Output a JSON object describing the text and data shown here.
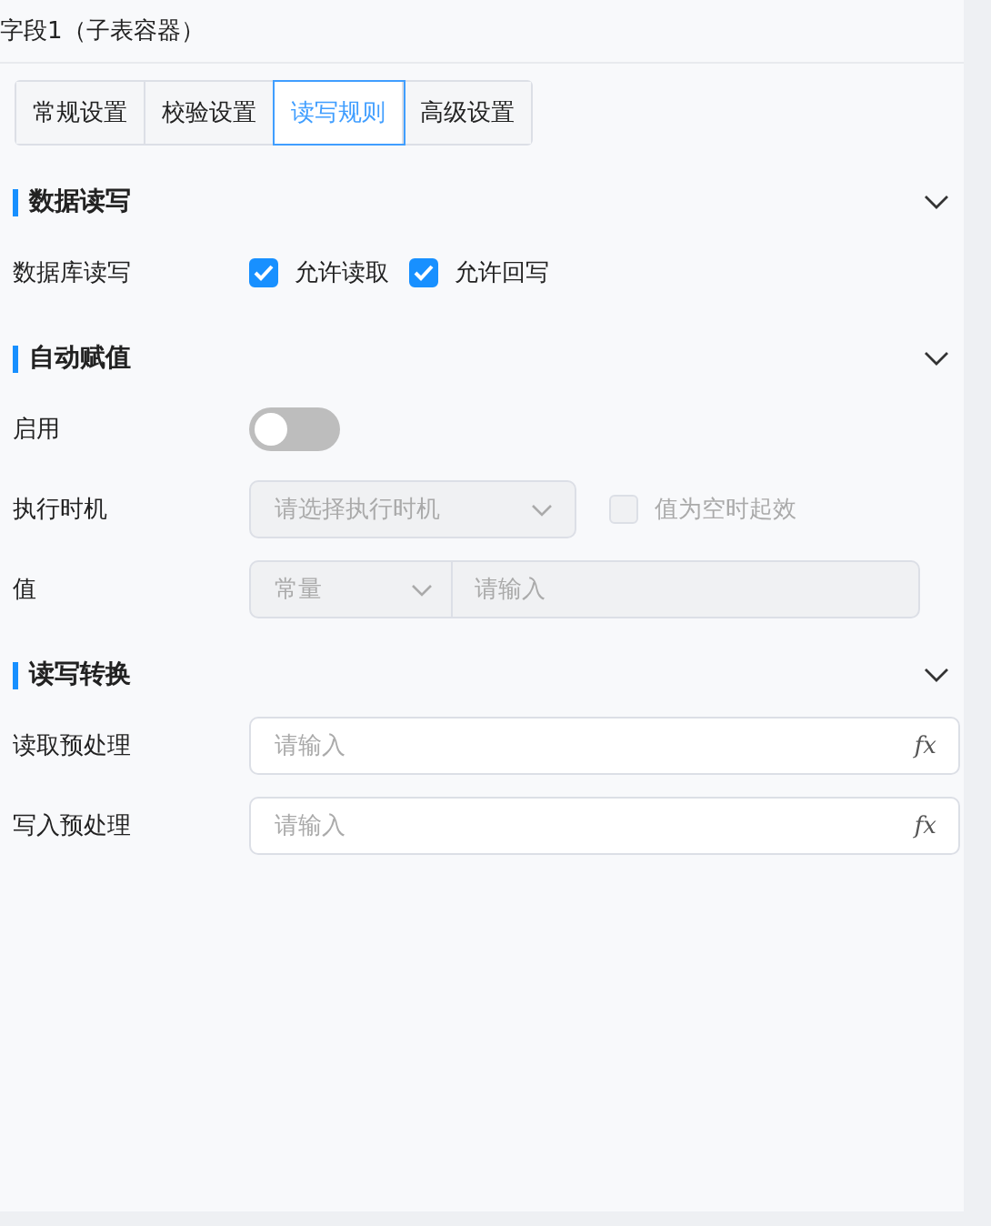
{
  "title": "字段1（子表容器）",
  "tabs": [
    {
      "label": "常规设置",
      "selected": false
    },
    {
      "label": "校验设置",
      "selected": false
    },
    {
      "label": "读写规则",
      "selected": true
    },
    {
      "label": "高级设置",
      "selected": false
    }
  ],
  "sections": [
    {
      "title": "数据读写",
      "expanded": true,
      "rows": [
        {
          "kind": "checkboxes",
          "label": "数据库读写",
          "options": [
            {
              "label": "允许读取",
              "checked": true
            },
            {
              "label": "允许回写",
              "checked": true
            }
          ]
        }
      ]
    },
    {
      "title": "自动赋值",
      "expanded": true,
      "rows": [
        {
          "kind": "switch",
          "label": "启用",
          "on": false
        },
        {
          "kind": "select_check",
          "label": "执行时机",
          "placeholder": "请选择执行时机",
          "disabled": true,
          "option": {
            "label": "值为空时起效",
            "checked": false
          }
        },
        {
          "kind": "select_input",
          "label": "值",
          "select_value": "常量",
          "placeholder": "请输入",
          "disabled": true
        }
      ]
    },
    {
      "title": "读写转换",
      "expanded": true,
      "rows": [
        {
          "kind": "formula",
          "label": "读取预处理",
          "placeholder": "请输入",
          "button": "fx"
        },
        {
          "kind": "formula",
          "label": "写入预处理",
          "placeholder": "请输入",
          "button": "fx"
        }
      ]
    }
  ]
}
